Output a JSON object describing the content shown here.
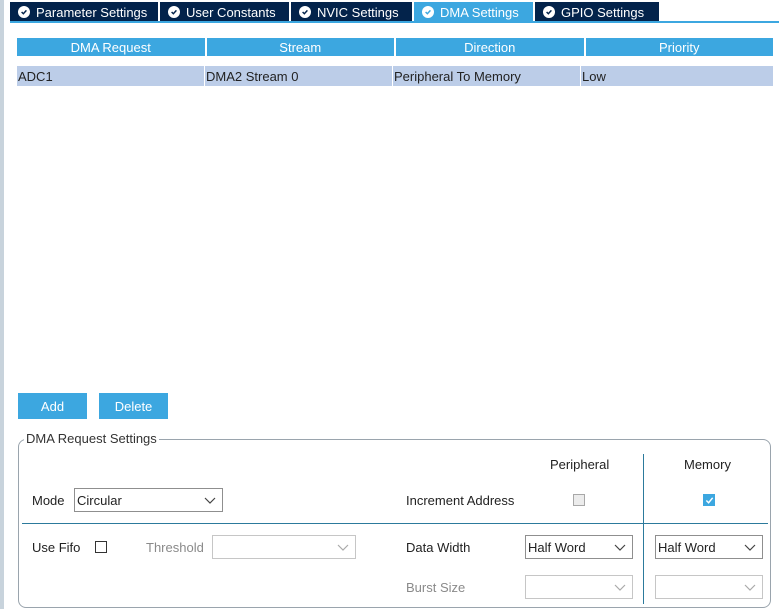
{
  "tabs": [
    {
      "label": "Parameter Settings",
      "active": false
    },
    {
      "label": "User Constants",
      "active": false
    },
    {
      "label": "NVIC Settings",
      "active": false
    },
    {
      "label": "DMA Settings",
      "active": true
    },
    {
      "label": "GPIO Settings",
      "active": false
    }
  ],
  "table": {
    "headers": [
      "DMA Request",
      "Stream",
      "Direction",
      "Priority"
    ],
    "rows": [
      [
        "ADC1",
        "DMA2 Stream 0",
        "Peripheral To Memory",
        "Low"
      ]
    ]
  },
  "buttons": {
    "add": "Add",
    "delete": "Delete"
  },
  "settings": {
    "group_title": "DMA Request Settings",
    "peripheral_header": "Peripheral",
    "memory_header": "Memory",
    "mode_label": "Mode",
    "mode_value": "Circular",
    "increment_label": "Increment Address",
    "increment_peripheral_checked": false,
    "increment_memory_checked": true,
    "use_fifo_label": "Use Fifo",
    "use_fifo_checked": false,
    "threshold_label": "Threshold",
    "threshold_value": "",
    "data_width_label": "Data Width",
    "data_width_peripheral": "Half Word",
    "data_width_memory": "Half Word",
    "burst_size_label": "Burst Size",
    "burst_size_peripheral": "",
    "burst_size_memory": ""
  },
  "colors": {
    "accent": "#3ca7e0",
    "tab_inactive": "#03234b",
    "selected_row": "#bccde8"
  }
}
